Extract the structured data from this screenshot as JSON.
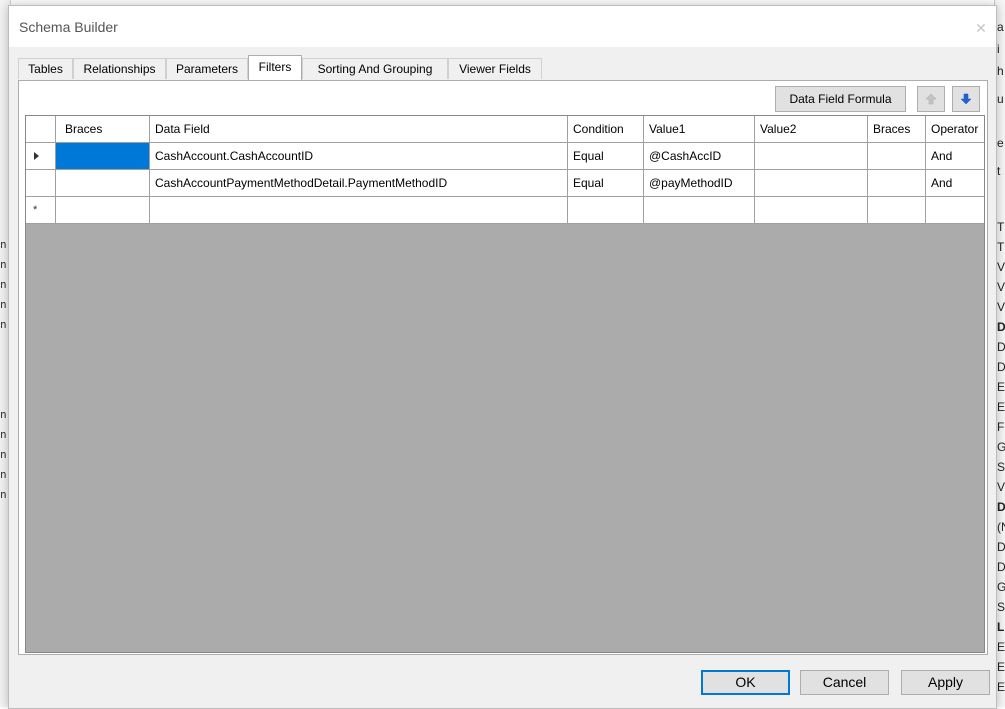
{
  "window": {
    "title": "Schema Builder",
    "close_glyph": "✕"
  },
  "tabs": [
    {
      "label": "Tables"
    },
    {
      "label": "Relationships"
    },
    {
      "label": "Parameters"
    },
    {
      "label": "Filters",
      "active": true
    },
    {
      "label": "Sorting And Grouping"
    },
    {
      "label": "Viewer Fields"
    }
  ],
  "toolbar": {
    "formula_label": "Data Field Formula",
    "move_up_icon": "arrow-up-icon",
    "move_down_icon": "arrow-down-icon"
  },
  "grid": {
    "columns": [
      "Braces",
      "Data Field",
      "Condition",
      "Value1",
      "Value2",
      "Braces",
      "Operator"
    ],
    "rows": [
      {
        "braces1": "",
        "data_field": "CashAccount.CashAccountID",
        "condition": "Equal",
        "value1": "@CashAccID",
        "value2": "",
        "braces2": "",
        "operator": "And"
      },
      {
        "braces1": "",
        "data_field": "CashAccountPaymentMethodDetail.PaymentMethodID",
        "condition": "Equal",
        "value1": "@payMethodID",
        "value2": "",
        "braces2": "",
        "operator": "And"
      }
    ],
    "new_row_glyph": "*"
  },
  "buttons": {
    "ok": "OK",
    "cancel": "Cancel",
    "apply": "Apply"
  },
  "colors": {
    "selection": "#0078d7",
    "grid_background": "#ababab"
  }
}
